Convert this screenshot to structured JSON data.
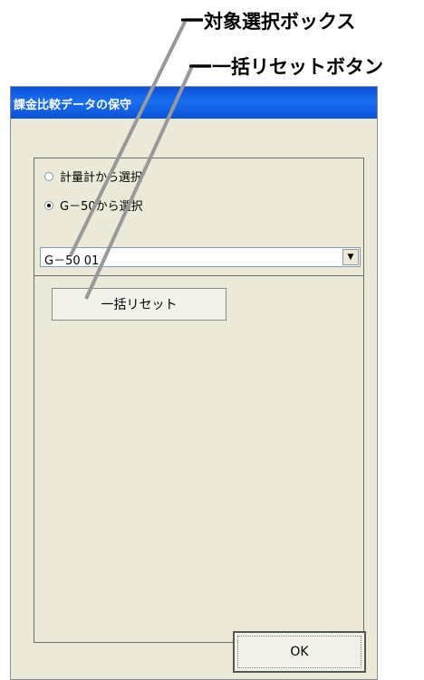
{
  "annotations": {
    "target_box": "対象選択ボックス",
    "bulk_reset": "一括リセットボタン"
  },
  "window": {
    "title": "課金比較データの保守",
    "title_color": "#0a52d8"
  },
  "radio": {
    "option1": "計量計から選択",
    "option2": "G－50から選択",
    "selected": "option2"
  },
  "combo": {
    "value": "G－50 01",
    "dropdown_icon": "chevron-down-icon"
  },
  "buttons": {
    "reset": "一括リセット",
    "ok": "OK"
  }
}
